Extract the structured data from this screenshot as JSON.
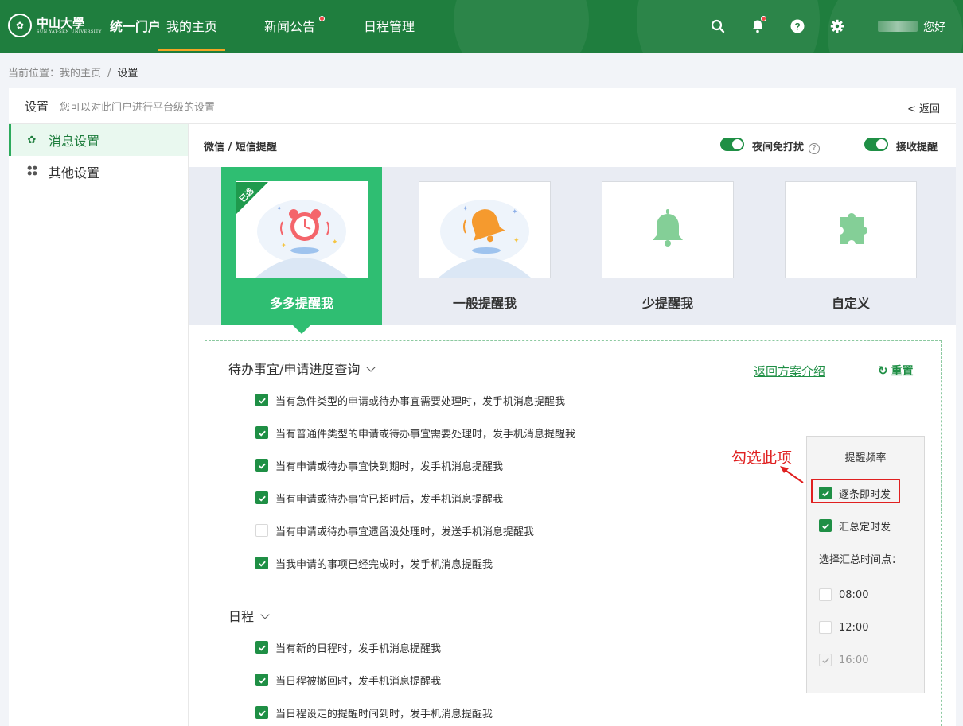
{
  "header": {
    "logo_school": "中山大學",
    "logo_school_en": "SUN YAT-SEN UNIVERSITY",
    "portal": "统一门户",
    "nav": [
      {
        "label": "我的主页",
        "active": true,
        "dot": false
      },
      {
        "label": "新闻公告",
        "active": false,
        "dot": true
      },
      {
        "label": "日程管理",
        "active": false,
        "dot": false
      }
    ],
    "icons": [
      "search-icon",
      "bell-icon",
      "help-icon",
      "gear-icon"
    ],
    "greeting": "您好",
    "colors": {
      "bar": "#1f7e3e",
      "active_underline": "#f5a623",
      "dot": "#f04848"
    }
  },
  "breadcrumb": {
    "prefix": "当前位置：",
    "items": [
      "我的主页",
      "设置"
    ]
  },
  "panel": {
    "title": "设置",
    "desc": "您可以对此门户进行平台级的设置",
    "back": "< 返回"
  },
  "sidebar": {
    "items": [
      {
        "label": "消息设置",
        "icon": "gear-icon",
        "active": true
      },
      {
        "label": "其他设置",
        "icon": "grid-icon",
        "active": false
      }
    ]
  },
  "settings_bar": {
    "title": "微信 / 短信提醒",
    "toggles": [
      {
        "label": "夜间免打扰",
        "on": true,
        "help": true
      },
      {
        "label": "接收提醒",
        "on": true,
        "help": false
      }
    ]
  },
  "modes": {
    "selected_badge": "已选",
    "items": [
      {
        "label": "多多提醒我",
        "icon": "alarm-clock-icon",
        "selected": true
      },
      {
        "label": "一般提醒我",
        "icon": "ringing-bell-icon",
        "selected": false
      },
      {
        "label": "少提醒我",
        "icon": "bell-icon",
        "selected": false
      },
      {
        "label": "自定义",
        "icon": "puzzle-icon",
        "selected": false
      }
    ]
  },
  "detail": {
    "back_link": "返回方案介绍",
    "reset": "重置",
    "sections": [
      {
        "title": "待办事宜/申请进度查询",
        "items": [
          {
            "label": "当有急件类型的申请或待办事宜需要处理时，发手机消息提醒我",
            "checked": true
          },
          {
            "label": "当有普通件类型的申请或待办事宜需要处理时，发手机消息提醒我",
            "checked": true
          },
          {
            "label": "当有申请或待办事宜快到期时，发手机消息提醒我",
            "checked": true
          },
          {
            "label": "当有申请或待办事宜已超时后，发手机消息提醒我",
            "checked": true
          },
          {
            "label": "当有申请或待办事宜遗留没处理时，发送手机消息提醒我",
            "checked": false
          },
          {
            "label": "当我申请的事项已经完成时，发手机消息提醒我",
            "checked": true
          }
        ]
      },
      {
        "title": "日程",
        "items": [
          {
            "label": "当有新的日程时，发手机消息提醒我",
            "checked": true
          },
          {
            "label": "当日程被撤回时，发手机消息提醒我",
            "checked": true
          },
          {
            "label": "当日程设定的提醒时间到时，发手机消息提醒我",
            "checked": true
          }
        ]
      }
    ]
  },
  "frequency": {
    "title": "提醒频率",
    "options": [
      {
        "label": "逐条即时发",
        "checked": true
      },
      {
        "label": "汇总定时发",
        "checked": true
      }
    ],
    "time_title": "选择汇总时间点：",
    "times": [
      {
        "label": "08:00",
        "state": "off"
      },
      {
        "label": "12:00",
        "state": "off"
      },
      {
        "label": "16:00",
        "state": "disabled-checked"
      }
    ]
  },
  "annotation": {
    "text": "勾选此项",
    "color": "#e02020"
  }
}
